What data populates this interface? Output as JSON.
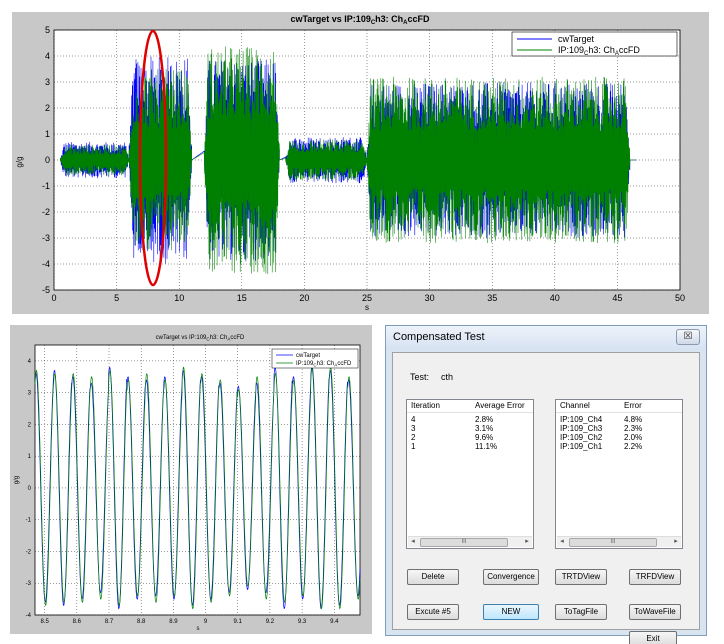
{
  "top_figure": {
    "title": "cwTarget  vs  IP:109_Ch3: Ch_AccFD",
    "title_main": "cwTarget  vs  IP:109",
    "title_sub1": "C",
    "title_mid": "h3: Ch",
    "title_sub2": "A",
    "title_end": "ccFD",
    "xlabel": "s",
    "ylabel": "g/g",
    "legend": [
      "cwTarget",
      "IP:109_Ch3: Ch_AccFD"
    ],
    "legend_items": [
      {
        "main": "cwTarget",
        "sub1": "",
        "mid": "",
        "sub2": "",
        "end": ""
      },
      {
        "main": "IP:109",
        "sub1": "C",
        "mid": "h3: Ch",
        "sub2": "A",
        "end": "ccFD"
      }
    ],
    "x_ticks": [
      "0",
      "5",
      "10",
      "15",
      "20",
      "25",
      "30",
      "35",
      "40",
      "45",
      "50"
    ],
    "y_ticks": [
      "5",
      "4",
      "3",
      "2",
      "1",
      "0",
      "-1",
      "-2",
      "-3",
      "-4",
      "-5"
    ]
  },
  "bottom_figure": {
    "title": "cwTarget  vs  IP:109_Ch3: Ch_AccFD",
    "title_main": "cwTarget  vs  IP:109",
    "title_sub1": "C",
    "title_mid": "h3: Ch",
    "title_sub2": "A",
    "title_end": "ccFD",
    "xlabel": "s",
    "ylabel": "g/g",
    "legend_items": [
      {
        "main": "cwTarget",
        "sub1": "",
        "mid": "",
        "sub2": "",
        "end": ""
      },
      {
        "main": "IP:109",
        "sub1": "C",
        "mid": "h3: Ch",
        "sub2": "A",
        "end": "ccFD"
      }
    ],
    "x_ticks": [
      "8.5",
      "8.6",
      "8.7",
      "8.8",
      "8.9",
      "9",
      "9.1",
      "9.2",
      "9.3",
      "9.4"
    ],
    "y_ticks": [
      "4",
      "3",
      "2",
      "1",
      "0",
      "-1",
      "-2",
      "-3",
      "-4"
    ]
  },
  "colors": {
    "target": "#0000ff",
    "response": "#008000",
    "highlight": "#e00000"
  },
  "dialog": {
    "title": "Compensated Test",
    "close_glyph": "☒",
    "test_label": "Test:",
    "test_value": "cth",
    "iteration_list": {
      "headers": [
        "Iteration",
        "Average Error"
      ],
      "rows": [
        [
          "4",
          "2.8%"
        ],
        [
          "3",
          "3.1%"
        ],
        [
          "2",
          "9.6%"
        ],
        [
          "1",
          "11.1%"
        ]
      ]
    },
    "channel_list": {
      "headers": [
        "Channel",
        "Error"
      ],
      "rows": [
        [
          "IP:109_Ch4",
          "4.8%"
        ],
        [
          "IP:109_Ch3",
          "2.3%"
        ],
        [
          "IP:109_Ch2",
          "2.0%"
        ],
        [
          "IP:109_Ch1",
          "2.2%"
        ]
      ]
    },
    "scroll_arrow_left": "◂",
    "scroll_arrow_right": "▸",
    "scroll_thumb": "III",
    "buttons": {
      "delete": "Delete",
      "convergence": "Convergence",
      "trtdview": "TRTDView",
      "trfdview": "TRFDView",
      "excute": "Excute #5",
      "new": "NEW",
      "totagfile": "ToTagFile",
      "towavefile": "ToWaveFile",
      "exit": "Exit"
    }
  },
  "chart_data": [
    {
      "type": "line",
      "title": "cwTarget  vs  IP:109_Ch3: Ch_AccFD",
      "xlabel": "s",
      "ylabel": "g/g",
      "xlim": [
        0,
        50
      ],
      "ylim": [
        -5,
        5
      ],
      "grid": true,
      "legend_position": "top-right",
      "series": [
        {
          "name": "cwTarget",
          "color": "#0000ff",
          "envelope_segments": [
            {
              "x": [
                0.5,
                6
              ],
              "amp": 0.7
            },
            {
              "x": [
                6,
                11
              ],
              "amp": 4.0
            },
            {
              "x": [
                12,
                18
              ],
              "amp": 3.9
            },
            {
              "x": [
                18.5,
                25
              ],
              "amp": 0.9
            },
            {
              "x": [
                25,
                46
              ],
              "amp": 3.0
            }
          ]
        },
        {
          "name": "IP:109_Ch3: Ch_AccFD",
          "color": "#008000",
          "envelope_segments": [
            {
              "x": [
                0.5,
                6
              ],
              "amp": 0.6
            },
            {
              "x": [
                6,
                11
              ],
              "amp": 3.5
            },
            {
              "x": [
                12,
                18
              ],
              "amp": 4.4
            },
            {
              "x": [
                18.5,
                25
              ],
              "amp": 0.8
            },
            {
              "x": [
                25,
                46
              ],
              "amp": 3.2
            }
          ]
        }
      ],
      "annotations": [
        {
          "type": "ellipse",
          "color": "#e00000",
          "x_center": 7.8,
          "y_range": [
            -5,
            5
          ]
        }
      ]
    },
    {
      "type": "line",
      "title": "cwTarget  vs  IP:109_Ch3: Ch_AccFD",
      "xlabel": "s",
      "ylabel": "g/g",
      "xlim": [
        8.47,
        9.48
      ],
      "ylim": [
        -4,
        4.5
      ],
      "grid": true,
      "legend_position": "top-right",
      "series": [
        {
          "name": "cwTarget",
          "color": "#0000ff",
          "frequency_hz": 17.5,
          "peaks": [
            3.6,
            3.7,
            3.5,
            3.3,
            3.8,
            3.5,
            3.4,
            3.5,
            3.7,
            3.5,
            3.3,
            3.2,
            3.3,
            3.8,
            3.5,
            3.8,
            3.7,
            3.4
          ]
        },
        {
          "name": "IP:109_Ch3: Ch_AccFD",
          "color": "#008000",
          "frequency_hz": 17.5,
          "peaks": [
            3.7,
            3.6,
            3.6,
            3.5,
            3.7,
            3.4,
            3.6,
            3.4,
            3.8,
            3.6,
            3.4,
            3.1,
            3.5,
            3.6,
            3.4,
            3.8,
            3.8,
            3.5
          ]
        }
      ]
    }
  ]
}
